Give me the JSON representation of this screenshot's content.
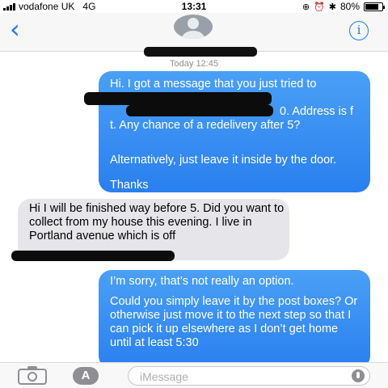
{
  "status_bar": {
    "carrier": "vodafone UK",
    "network": "4G",
    "time": "13:31",
    "battery": "80%",
    "battery_level": 0.8
  },
  "header": {
    "back_icon": "chevron-left-icon",
    "info_icon": "info-icon"
  },
  "conversation": {
    "timestamp": "Today 12:45",
    "messages": [
      {
        "sender": "me",
        "paragraphs": [
          "Hi. I got a message that you just tried to deliver",
          "0. Address is f",
          "t. Any chance of a redelivery after 5?",
          "Alternatively, just leave it inside by the door.",
          "Thanks"
        ]
      },
      {
        "sender": "them",
        "paragraphs": [
          "Hi I will be finished way before 5. Did you want to collect from my house this evening. I live in Portland avenue which is off"
        ]
      },
      {
        "sender": "me",
        "paragraphs": [
          "I’m sorry, that’s not really an option.",
          "Could you simply leave it by the post boxes? Or otherwise just move it to the next step so that I can pick it up elsewhere as I don’t get home until at least 5:30"
        ]
      }
    ]
  },
  "composer": {
    "placeholder": "iMessage",
    "camera_icon": "camera-icon",
    "apps_icon": "app-store-icon",
    "mic_icon": "microphone-icon"
  }
}
